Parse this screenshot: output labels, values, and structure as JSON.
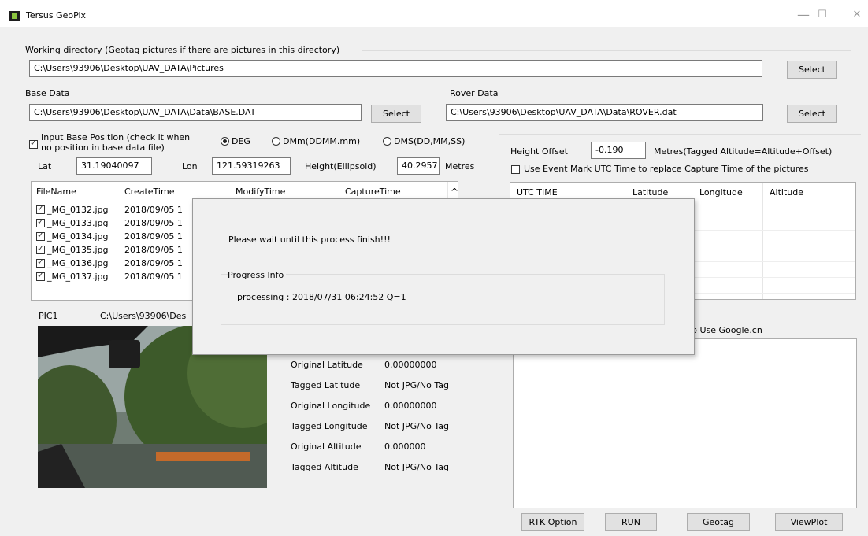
{
  "window": {
    "title": "Tersus GeoPix",
    "minimize_glyph": "—",
    "maximize_glyph": "☐",
    "close_glyph": "✕"
  },
  "working_dir": {
    "label": "Working directory (Geotag pictures if there are pictures in this directory)",
    "value": "C:\\Users\\93906\\Desktop\\UAV_DATA\\Pictures",
    "select_label": "Select"
  },
  "base_data": {
    "label": "Base Data",
    "value": "C:\\Users\\93906\\Desktop\\UAV_DATA\\Data\\BASE.DAT",
    "select_label": "Select"
  },
  "rover_data": {
    "label": "Rover Data",
    "value": "C:\\Users\\93906\\Desktop\\UAV_DATA\\Data\\ROVER.dat",
    "select_label": "Select"
  },
  "base_position": {
    "checkbox_label_line1": "Input Base Position (check it when",
    "checkbox_label_line2": "no position in base data file)",
    "checked": true,
    "radio_deg": "DEG",
    "radio_dmm": "DMm(DDMM.mm)",
    "radio_dms": "DMS(DD,MM,SS)",
    "lat_label": "Lat",
    "lat_value": "31.19040097",
    "lon_label": "Lon",
    "lon_value": "121.59319263",
    "height_label": "Height(Ellipsoid)",
    "height_value": "40.2957",
    "height_unit": "Metres"
  },
  "height_offset": {
    "label": "Height Offset",
    "value": "-0.190",
    "unit_label": "Metres(Tagged Altitude=Altitude+Offset)",
    "event_mark_label": "Use Event Mark UTC Time to replace Capture Time of the pictures"
  },
  "file_list": {
    "columns": [
      "FileName",
      "CreateTime",
      "ModifyTime",
      "CaptureTime"
    ],
    "rows": [
      {
        "name": "_MG_0132.jpg",
        "create": "2018/09/05 1"
      },
      {
        "name": "_MG_0133.jpg",
        "create": "2018/09/05 1"
      },
      {
        "name": "_MG_0134.jpg",
        "create": "2018/09/05 1"
      },
      {
        "name": "_MG_0135.jpg",
        "create": "2018/09/05 1"
      },
      {
        "name": "_MG_0136.jpg",
        "create": "2018/09/05 1"
      },
      {
        "name": "_MG_0137.jpg",
        "create": "2018/09/05 1"
      }
    ],
    "scroll_up_glyph": "^"
  },
  "utc_table": {
    "columns": [
      "UTC TIME",
      "Latitude",
      "Longitude",
      "Altitude"
    ]
  },
  "picture": {
    "label": "PIC1",
    "path": "C:\\Users\\93906\\Des"
  },
  "tag_info": {
    "rows": [
      {
        "label": "Original Latitude",
        "value": "0.00000000"
      },
      {
        "label": "Tagged Latitude",
        "value": "Not JPG/No Tag"
      },
      {
        "label": "Original Longitude",
        "value": "0.00000000"
      },
      {
        "label": "Tagged Longitude",
        "value": "Not JPG/No Tag"
      },
      {
        "label": "Original Altitude",
        "value": "0.000000"
      },
      {
        "label": "Tagged Altitude",
        "value": "Not JPG/No Tag"
      }
    ]
  },
  "map": {
    "label": "p Use Google.cn"
  },
  "actions": {
    "rtk_option": "RTK Option",
    "run": "RUN",
    "geotag": "Geotag",
    "viewplot": "ViewPlot"
  },
  "dialog": {
    "message": "Please wait until this process finish!!!",
    "group_label": "Progress Info",
    "progress_text": "processing : 2018/07/31 06:24:52 Q=1"
  }
}
